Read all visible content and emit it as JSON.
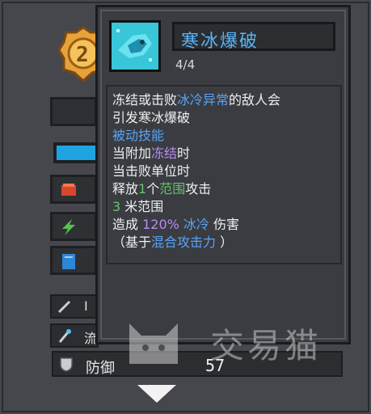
{
  "background": {
    "badge_number": "2",
    "defense": {
      "label": "防御",
      "value": "57"
    },
    "partial_labels": [
      "I",
      "流"
    ]
  },
  "tooltip": {
    "skill_name": "寒冰爆破",
    "level": "4/4",
    "description": {
      "l1": {
        "a": "冻结或击败",
        "b": "冰冷异常",
        "c": "的敌人会"
      },
      "l2": {
        "a": "引发寒冰爆破"
      },
      "l3": {
        "a": "被动技能"
      },
      "l4": {
        "a": "当附加",
        "b": "冻结",
        "c": "时"
      },
      "l5": {
        "a": "当击败单位时"
      },
      "l6": {
        "a": "释放",
        "b": "1",
        "c": "个",
        "d": "范围",
        "e": "攻击"
      },
      "l7": {
        "a": "3",
        "b": " 米范围"
      },
      "l8": {
        "a": "造成 ",
        "b": "120%",
        "c": " 冰冷",
        "d": " 伤害"
      },
      "l9": {
        "a": "（基于",
        "b": "混合攻击力",
        "c": " ）"
      }
    }
  },
  "watermark": {
    "text": "交易猫"
  },
  "colors": {
    "title_blue": "#59b4f7",
    "keyword_blue": "#59a3f5",
    "purple": "#b58ef2",
    "green": "#62c56a",
    "bar_blue": "#1ea2e0"
  }
}
